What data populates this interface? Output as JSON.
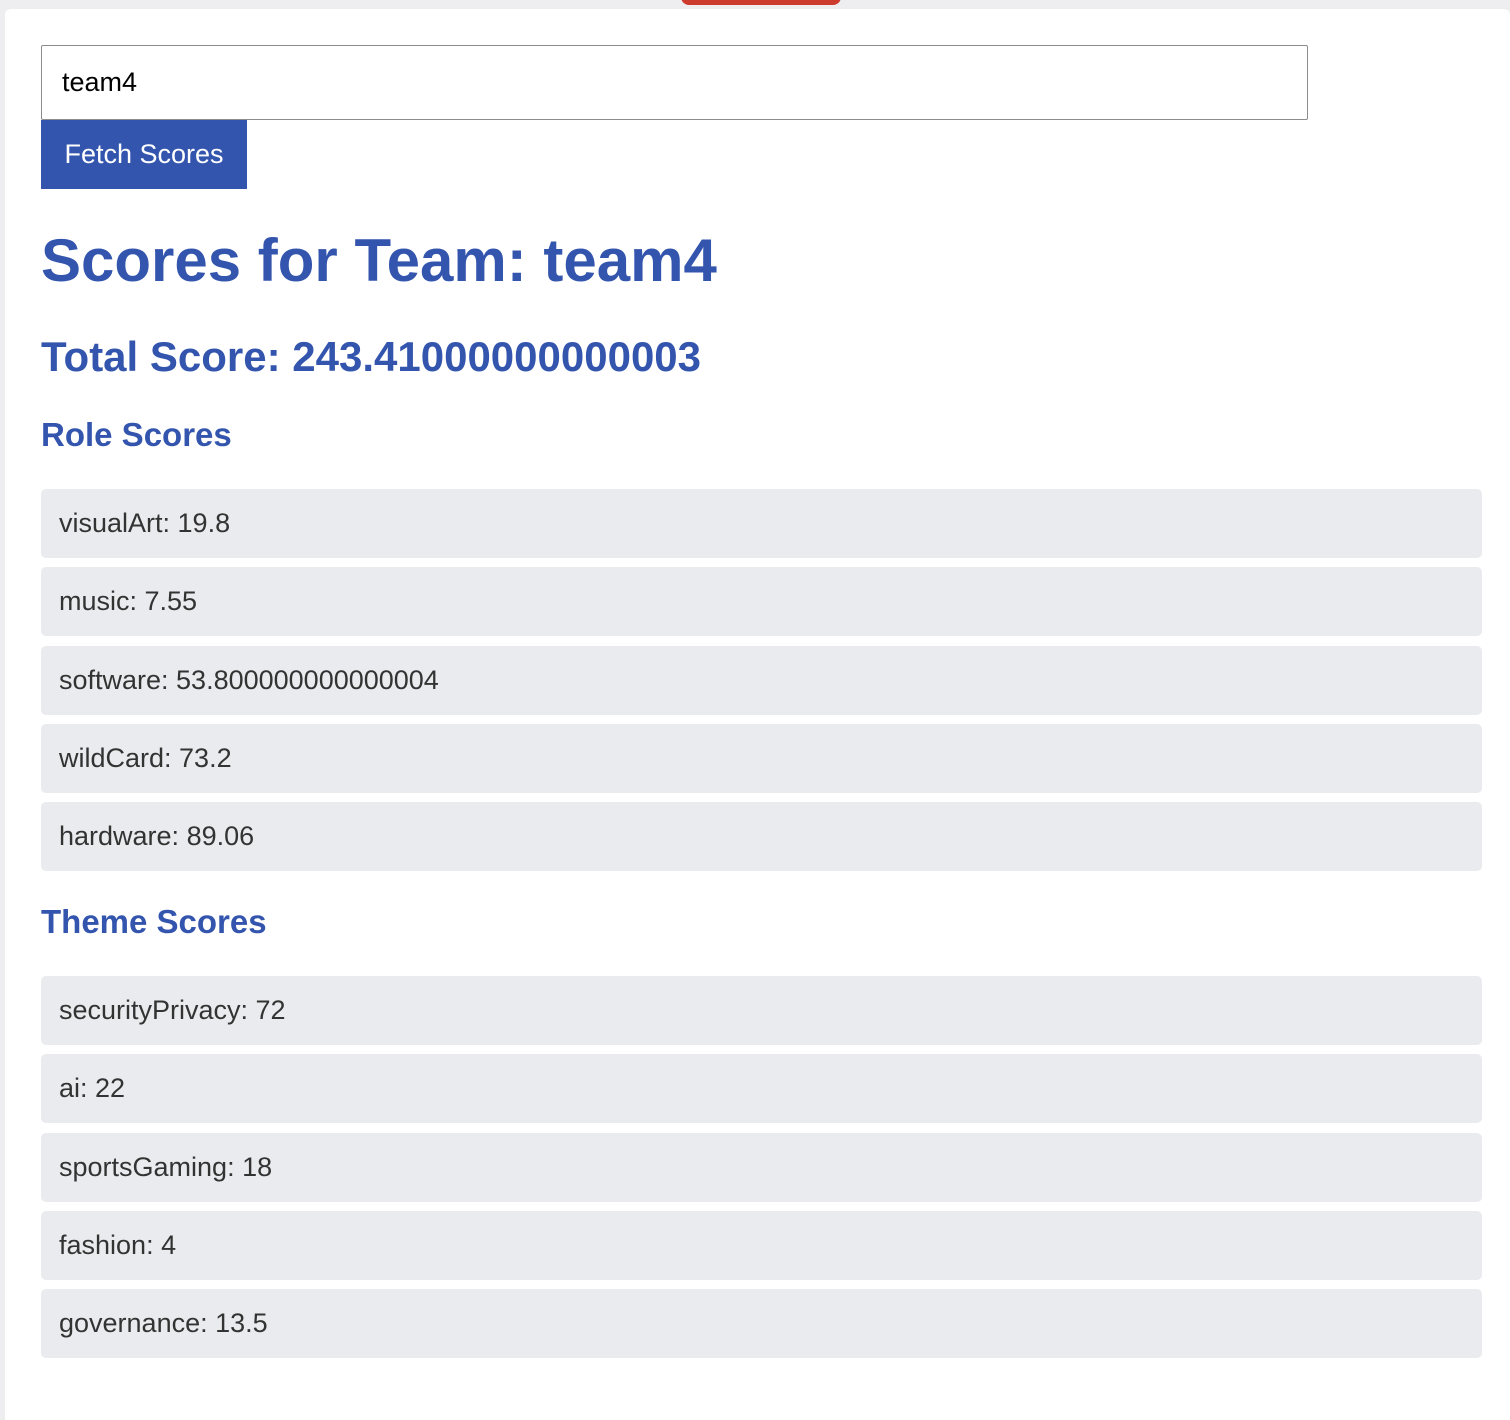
{
  "search": {
    "value": "team4"
  },
  "fetch_button_label": "Fetch Scores",
  "title": "Scores for Team: team4",
  "total_score": "Total Score: 243.41000000000003",
  "role_scores": {
    "heading": "Role Scores",
    "items": [
      {
        "text": "visualArt: 19.8"
      },
      {
        "text": "music: 7.55"
      },
      {
        "text": "software: 53.800000000000004"
      },
      {
        "text": "wildCard: 73.2"
      },
      {
        "text": "hardware: 89.06"
      }
    ]
  },
  "theme_scores": {
    "heading": "Theme Scores",
    "items": [
      {
        "text": "securityPrivacy: 72"
      },
      {
        "text": "ai: 22"
      },
      {
        "text": "sportsGaming: 18"
      },
      {
        "text": "fashion: 4"
      },
      {
        "text": "governance: 13.5"
      }
    ]
  },
  "colors": {
    "accent": "#3355ad",
    "top_tab": "#cc3b2c",
    "list_item_bg": "#eaebee",
    "page_bg": "#eeeef1"
  }
}
